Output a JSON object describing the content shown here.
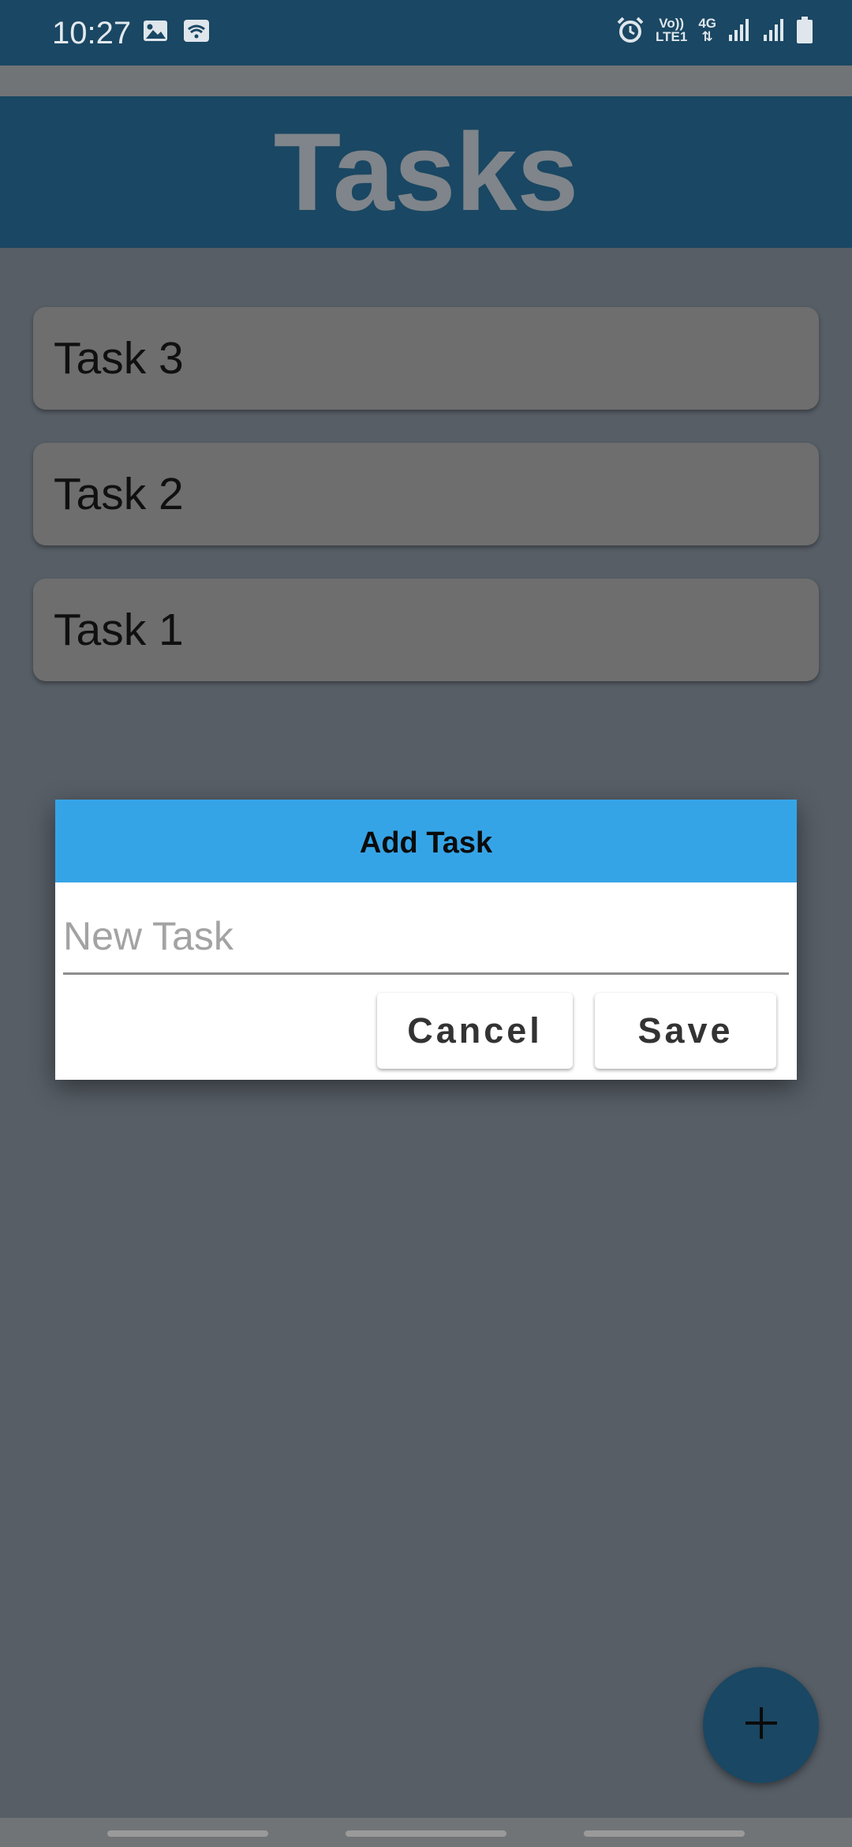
{
  "status_bar": {
    "time": "10:27",
    "left_icons": [
      "image-icon",
      "wifi-icon"
    ],
    "right_icons": [
      "alarm-icon",
      "volte-icon",
      "4g-icon",
      "signal-icon",
      "signal-icon",
      "battery-icon"
    ],
    "volte_top": "Vo))",
    "volte_bottom": "LTE1",
    "network_type": "4G"
  },
  "app": {
    "title": "Tasks",
    "tasks": [
      "Task 3",
      "Task 2",
      "Task 1"
    ]
  },
  "dialog": {
    "title": "Add Task",
    "input_value": "",
    "input_placeholder": "New Task",
    "cancel_label": "Cancel",
    "save_label": "Save",
    "header_color": "#35a4e6"
  },
  "fab": {
    "icon": "plus-icon"
  },
  "colors": {
    "primary": "#1a4763",
    "scrim": "#575e66",
    "accent": "#35a4e6"
  }
}
